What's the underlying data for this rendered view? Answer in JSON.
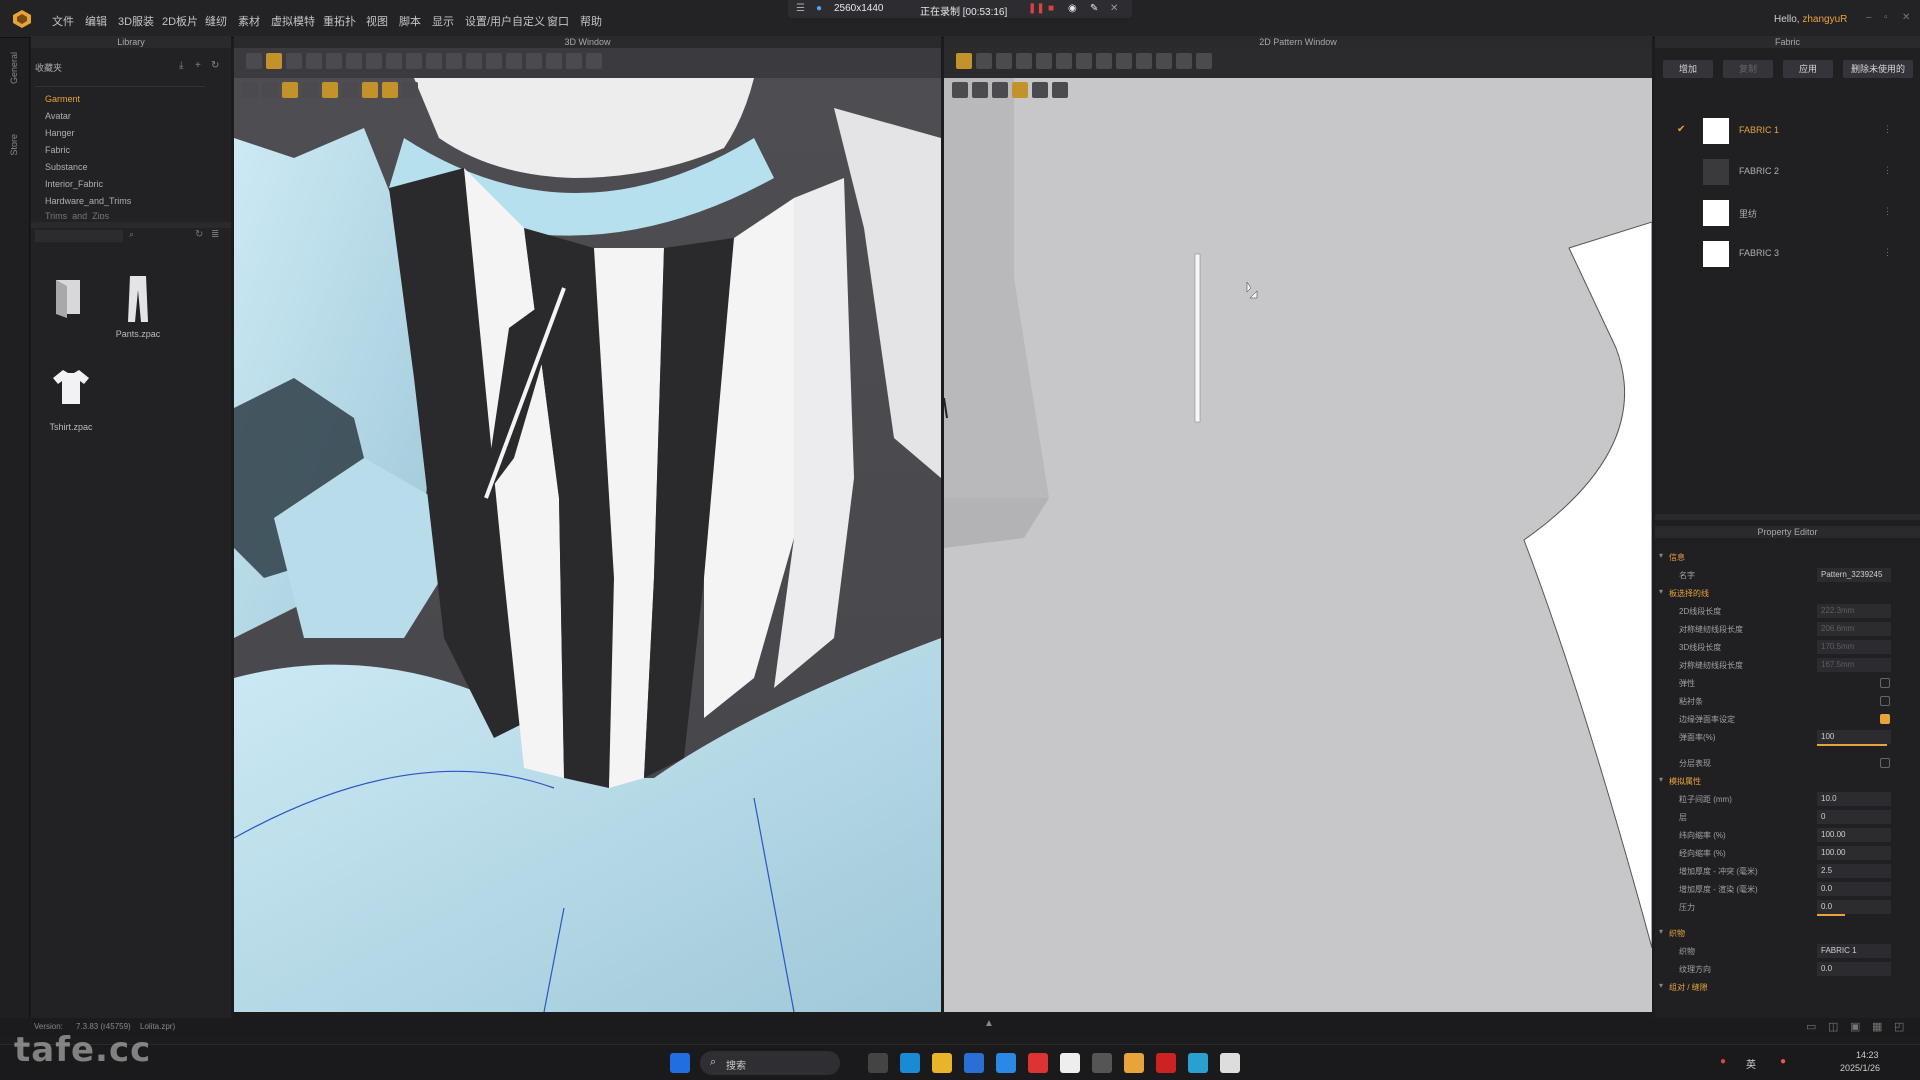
{
  "menubar": {
    "items": [
      "文件",
      "编辑",
      "3D服装",
      "2D板片",
      "缝纫",
      "素材",
      "虚拟模特",
      "重拓扑",
      "视图",
      "脚本",
      "显示",
      "设置/用户自定义",
      "窗口",
      "帮助"
    ],
    "recording": {
      "resolution": "2560x1440",
      "status": "正在录制 [00:53:16]"
    },
    "hello_prefix": "Hello,",
    "user_name": "zhangyuR"
  },
  "left_strip": {
    "tabs": [
      "General",
      "Store"
    ]
  },
  "library": {
    "title": "Library",
    "favorites_label": "收藏夹",
    "items": [
      "Garment",
      "Avatar",
      "Hanger",
      "Fabric",
      "Substance",
      "Interior_Fabric",
      "Hardware_and_Trims",
      "Trims_and_Zips"
    ],
    "active_item": "Garment",
    "files": [
      "",
      "Pants.zpac",
      "Tshirt.zpac"
    ]
  },
  "window3d": {
    "title": "3D Window"
  },
  "window2d": {
    "title": "2D Pattern Window"
  },
  "fabric_panel": {
    "title": "Fabric",
    "buttons": [
      "增加",
      "复制",
      "应用",
      "删除未使用的"
    ],
    "fabrics": [
      {
        "name": "FABRIC 1",
        "color": "#ffffff",
        "active": true
      },
      {
        "name": "FABRIC 2",
        "color": "#3a3a3d",
        "active": false
      },
      {
        "name": "里纺",
        "color": "#ffffff",
        "active": false
      },
      {
        "name": "FABRIC 3",
        "color": "#ffffff",
        "active": false
      }
    ]
  },
  "property_editor": {
    "title": "Property Editor",
    "rows": [
      {
        "label": "信息",
        "section": true
      },
      {
        "label": "名字",
        "value": "Pattern_3239245"
      },
      {
        "label": "板选择的线",
        "section": true
      },
      {
        "label": "2D线段长度",
        "value": "222.3mm",
        "dim": true
      },
      {
        "label": "对称缝纫线段长度",
        "value": "206.6mm",
        "dim": true
      },
      {
        "label": "3D线段长度",
        "value": "170.5mm",
        "dim": true
      },
      {
        "label": "对称缝纫线段长度",
        "value": "167.5mm",
        "dim": true
      },
      {
        "label": "弹性",
        "checkbox": false
      },
      {
        "label": "粘衬条",
        "checkbox": false
      },
      {
        "label": "边缘弹面率设定",
        "checkbox": true
      },
      {
        "label": "弹面率(%)",
        "value": "100",
        "slider": 1.0
      },
      {
        "label": "分层表现",
        "checkbox": false
      },
      {
        "label": "模拟属性",
        "section": true
      },
      {
        "label": "粒子间距 (mm)",
        "value": "10.0"
      },
      {
        "label": "层",
        "value": "0"
      },
      {
        "label": "纬向缩率 (%)",
        "value": "100.00"
      },
      {
        "label": "经向缩率 (%)",
        "value": "100.00"
      },
      {
        "label": "增加厚度 - 冲突 (毫米)",
        "value": "2.5"
      },
      {
        "label": "增加厚度 - 渲染 (毫米)",
        "value": "0.0"
      },
      {
        "label": "压力",
        "value": "0.0",
        "slider": 0.4
      },
      {
        "label": "织物",
        "section": true
      },
      {
        "label": "织物",
        "value": "FABRIC 1"
      },
      {
        "label": "纹理方向",
        "value": "0.0"
      },
      {
        "label": "组对 / 缝隙",
        "section": true
      }
    ]
  },
  "status": {
    "version_label": "Version:",
    "version": "7.3.83 (r45759)",
    "file": "Lolita.zpr)"
  },
  "taskbar": {
    "search_placeholder": "搜索",
    "lang": "英",
    "time": "14:23",
    "date": "2025/1/26"
  },
  "watermark": "tafe.cc",
  "colors": {
    "accent": "#e8a33a",
    "garment_light_blue": "#c4e6f2",
    "stripe_dark": "#2a2a2c",
    "pattern_bg": "#c7c7c9"
  }
}
